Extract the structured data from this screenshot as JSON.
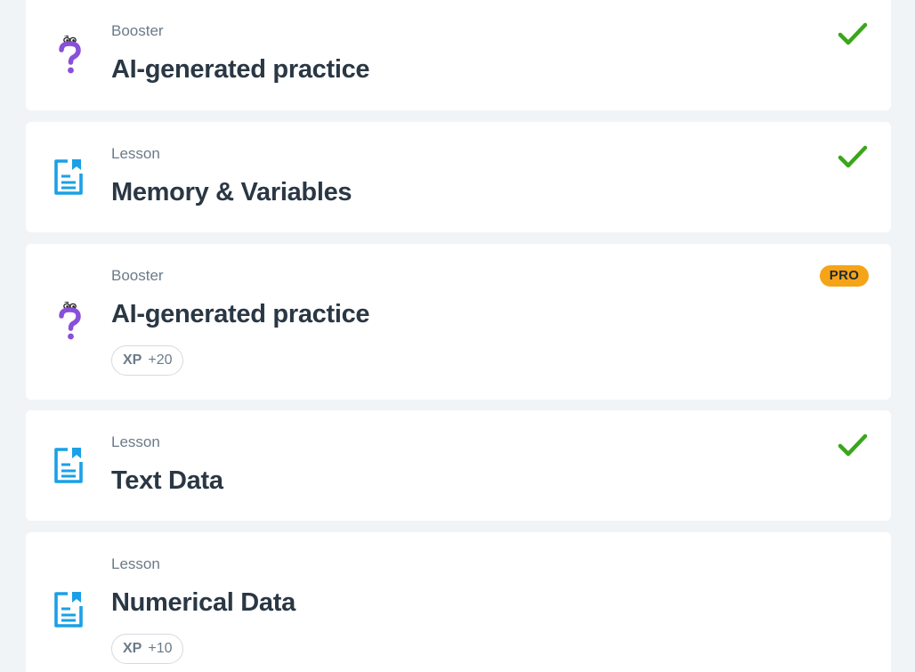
{
  "cards": [
    {
      "type": "Booster",
      "title": "AI-generated practice",
      "icon": "question-character-icon",
      "status": "completed"
    },
    {
      "type": "Lesson",
      "title": "Memory & Variables",
      "icon": "lesson-document-icon",
      "status": "completed"
    },
    {
      "type": "Booster",
      "title": "AI-generated practice",
      "icon": "question-character-icon",
      "badge": "PRO",
      "xp_label": "XP",
      "xp_value": "+20"
    },
    {
      "type": "Lesson",
      "title": "Text Data",
      "icon": "lesson-document-icon",
      "status": "completed"
    },
    {
      "type": "Lesson",
      "title": "Numerical Data",
      "icon": "lesson-document-icon",
      "xp_label": "XP",
      "xp_value": "+10"
    }
  ],
  "colors": {
    "background": "#f1f4f7",
    "card": "#ffffff",
    "check": "#3aa61a",
    "pro_badge": "#f6a417",
    "booster_icon": "#8a4fd9",
    "lesson_icon": "#1aa0e6",
    "title_text": "#2a3744",
    "muted_text": "#6b7a89"
  }
}
